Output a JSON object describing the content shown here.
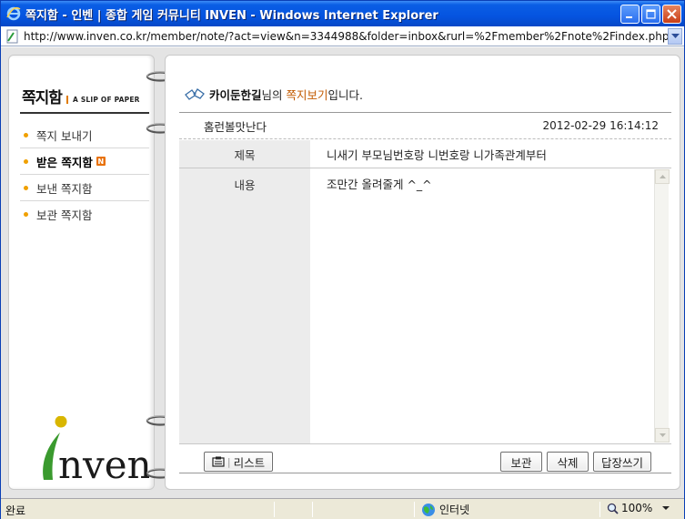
{
  "window": {
    "title": "쪽지함 - 인벤 | 종합 게임 커뮤니티 INVEN - Windows Internet Explorer",
    "url": "http://www.inven.co.kr/member/note/?act=view&n=3344988&folder=inbox&rurl=%2Fmember%2Fnote%2Findex.php%3Fasnew"
  },
  "sidebar": {
    "logo_title": "쪽지함",
    "logo_subtitle": "A SLIP OF PAPER",
    "items": [
      {
        "label": "쪽지 보내기"
      },
      {
        "label": "받은 쪽지함",
        "badge": "N",
        "active": true
      },
      {
        "label": "보낸 쪽지함"
      },
      {
        "label": "보관 쪽지함"
      }
    ],
    "brand": "nven",
    "brand_initial": "i"
  },
  "message": {
    "greeting_nick": "카이둔한길",
    "greeting_mid": "님의 ",
    "greeting_highlight": "쪽지보기",
    "greeting_end": "입니다.",
    "sender": "홈런볼맛난다",
    "date": "2012-02-29 16:14:12",
    "title_label": "제목",
    "title_value": "니새기 부모님번호랑 니번호랑 니가족관계부터",
    "body_label": "내용",
    "body_value": "조만간 올려줄게 ^_^"
  },
  "buttons": {
    "list": "리스트",
    "list_sep": "|",
    "save": "보관",
    "delete": "삭제",
    "reply": "답장쓰기"
  },
  "statusbar": {
    "status": "완료",
    "zone": "인터넷",
    "zoom": "100%"
  },
  "colors": {
    "titlebar": "#0554e0",
    "accent": "#c25a00",
    "menu_dot": "#f0a000",
    "brand_green": "#3a9a2e",
    "brand_yellow": "#d9b600"
  }
}
